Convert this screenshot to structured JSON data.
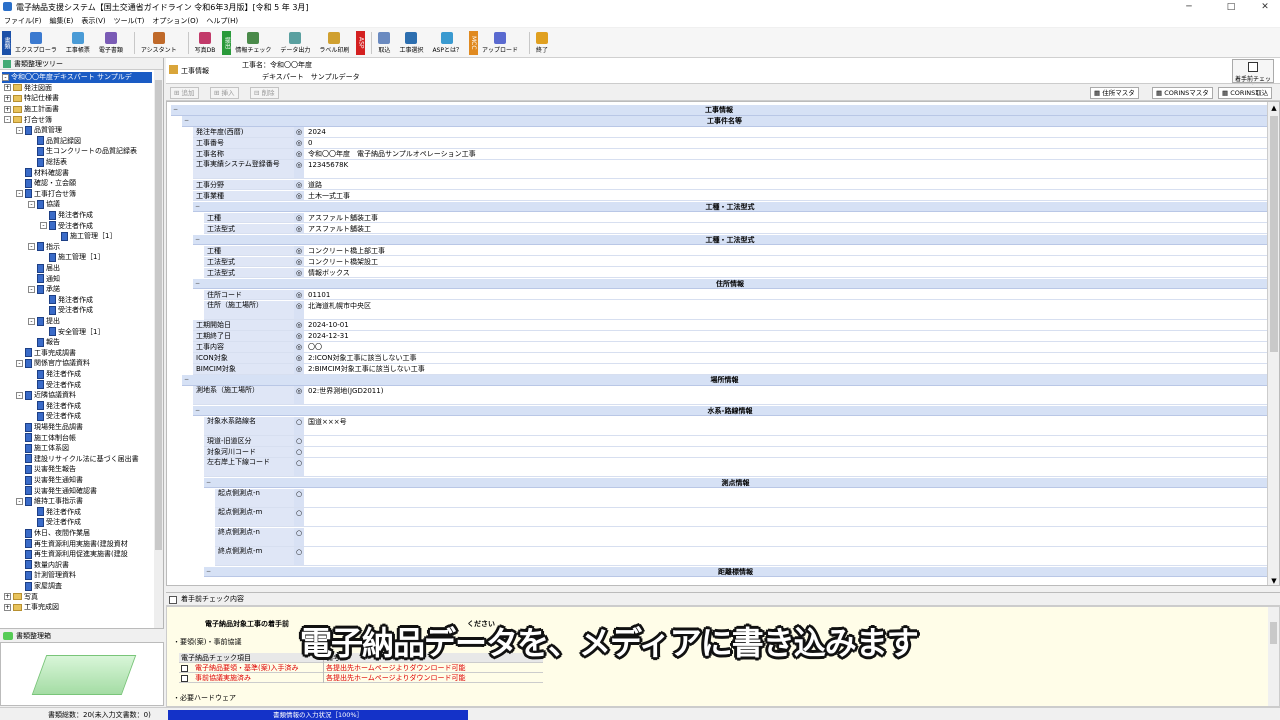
{
  "window": {
    "title": "電子納品支援システム【国土交通省ガイドライン 令和6年3月版】[令和 5 年 3月]"
  },
  "menu": [
    "ファイル(F)",
    "編集(E)",
    "表示(V)",
    "ツール(T)",
    "オプション(O)",
    "ヘルプ(H)"
  ],
  "toolbar": {
    "vtags": [
      "書類",
      "提出",
      "ASP",
      "MCC"
    ],
    "buttons": [
      "エクスプローラ",
      "工事帳票",
      "電子書類",
      "アシスタント",
      "写真DB",
      "情報チェック",
      "データ出力",
      "ラベル印刷",
      "取込",
      "工事選択",
      "ASPとは？",
      "アップロード",
      "終了"
    ]
  },
  "tree": {
    "header": "書類整理ツリー",
    "root": "令和〇〇年度デキスパート サンプルデ",
    "items": [
      {
        "label": "発注図面",
        "level": 0,
        "kind": "folder",
        "pm": "+"
      },
      {
        "label": "特記仕様書",
        "level": 0,
        "kind": "folder",
        "pm": "+"
      },
      {
        "label": "施工計画書",
        "level": 0,
        "kind": "folder",
        "pm": "+"
      },
      {
        "label": "打合せ簿",
        "level": 0,
        "kind": "folder",
        "pm": "-"
      },
      {
        "label": "品質管理",
        "level": 1,
        "kind": "doc",
        "pm": "-"
      },
      {
        "label": "品質記録図",
        "level": 2,
        "kind": "doc",
        "pm": ""
      },
      {
        "label": "生コンクリートの品質記録表",
        "level": 2,
        "kind": "doc",
        "pm": ""
      },
      {
        "label": "総括表",
        "level": 2,
        "kind": "doc",
        "pm": ""
      },
      {
        "label": "材料確認書",
        "level": 1,
        "kind": "doc",
        "pm": ""
      },
      {
        "label": "確認・立会願",
        "level": 1,
        "kind": "doc",
        "pm": ""
      },
      {
        "label": "工事打合せ簿",
        "level": 1,
        "kind": "doc",
        "pm": "-"
      },
      {
        "label": "協議",
        "level": 2,
        "kind": "doc",
        "pm": "-"
      },
      {
        "label": "発注者作成",
        "level": 3,
        "kind": "doc",
        "pm": ""
      },
      {
        "label": "受注者作成",
        "level": 3,
        "kind": "doc",
        "pm": "-"
      },
      {
        "label": "施工管理［1］",
        "level": 4,
        "kind": "doc",
        "pm": ""
      },
      {
        "label": "指示",
        "level": 2,
        "kind": "doc",
        "pm": "-"
      },
      {
        "label": "施工管理［1］",
        "level": 3,
        "kind": "doc",
        "pm": ""
      },
      {
        "label": "届出",
        "level": 2,
        "kind": "doc",
        "pm": ""
      },
      {
        "label": "通知",
        "level": 2,
        "kind": "doc",
        "pm": ""
      },
      {
        "label": "承諾",
        "level": 2,
        "kind": "doc",
        "pm": "-"
      },
      {
        "label": "発注者作成",
        "level": 3,
        "kind": "doc",
        "pm": ""
      },
      {
        "label": "受注者作成",
        "level": 3,
        "kind": "doc",
        "pm": ""
      },
      {
        "label": "提出",
        "level": 2,
        "kind": "doc",
        "pm": "-"
      },
      {
        "label": "安全管理［1］",
        "level": 3,
        "kind": "doc",
        "pm": ""
      },
      {
        "label": "報告",
        "level": 2,
        "kind": "doc",
        "pm": ""
      },
      {
        "label": "工事完成調書",
        "level": 1,
        "kind": "doc",
        "pm": ""
      },
      {
        "label": "関係官庁協議資料",
        "level": 1,
        "kind": "doc",
        "pm": "-"
      },
      {
        "label": "発注者作成",
        "level": 2,
        "kind": "doc",
        "pm": ""
      },
      {
        "label": "受注者作成",
        "level": 2,
        "kind": "doc",
        "pm": ""
      },
      {
        "label": "近隣協議資料",
        "level": 1,
        "kind": "doc",
        "pm": "-"
      },
      {
        "label": "発注者作成",
        "level": 2,
        "kind": "doc",
        "pm": ""
      },
      {
        "label": "受注者作成",
        "level": 2,
        "kind": "doc",
        "pm": ""
      },
      {
        "label": "現場発生品調書",
        "level": 1,
        "kind": "doc",
        "pm": ""
      },
      {
        "label": "施工体制台帳",
        "level": 1,
        "kind": "doc",
        "pm": ""
      },
      {
        "label": "施工体系図",
        "level": 1,
        "kind": "doc",
        "pm": ""
      },
      {
        "label": "建設リサイクル法に基づく届出書",
        "level": 1,
        "kind": "doc",
        "pm": ""
      },
      {
        "label": "災害発生報告",
        "level": 1,
        "kind": "doc",
        "pm": ""
      },
      {
        "label": "災害発生通知書",
        "level": 1,
        "kind": "doc",
        "pm": ""
      },
      {
        "label": "災害発生通知確認書",
        "level": 1,
        "kind": "doc",
        "pm": ""
      },
      {
        "label": "維持工事指示書",
        "level": 1,
        "kind": "doc",
        "pm": "-"
      },
      {
        "label": "発注者作成",
        "level": 2,
        "kind": "doc",
        "pm": ""
      },
      {
        "label": "受注者作成",
        "level": 2,
        "kind": "doc",
        "pm": ""
      },
      {
        "label": "休日、夜間作業届",
        "level": 1,
        "kind": "doc",
        "pm": ""
      },
      {
        "label": "再生資源利用実施書(建設資材",
        "level": 1,
        "kind": "doc",
        "pm": ""
      },
      {
        "label": "再生資源利用促進実施書(建設",
        "level": 1,
        "kind": "doc",
        "pm": ""
      },
      {
        "label": "数量内訳書",
        "level": 1,
        "kind": "doc",
        "pm": ""
      },
      {
        "label": "計測管理資料",
        "level": 1,
        "kind": "doc",
        "pm": ""
      },
      {
        "label": "家屋調査",
        "level": 1,
        "kind": "doc",
        "pm": ""
      },
      {
        "label": "写真",
        "level": 0,
        "kind": "folder",
        "pm": "+"
      },
      {
        "label": "工事完成図",
        "level": 0,
        "kind": "folder",
        "pm": "+"
      }
    ]
  },
  "bin": {
    "label": "書類整理箱"
  },
  "status": {
    "tree": "書類総数：20(未入力文書数：0)",
    "progress": "書類情報の入力状況［100%］"
  },
  "main": {
    "title": "工事情報",
    "name_label": "工事名：令和〇〇年度",
    "name_value": "デキスパート　サンプルデータ",
    "check_btn": "着手前チェック",
    "sub": {
      "add": "追加",
      "insert": "挿入",
      "delete": "削除",
      "addr": "住所マスタ",
      "corins_m": "CORINSマスタ",
      "corins_i": "CORINS取込"
    }
  },
  "form": {
    "rows": [
      {
        "t": "sec",
        "text": "工事情報",
        "d": 0
      },
      {
        "t": "sec",
        "text": "工事件名等",
        "d": 1
      },
      {
        "t": "f",
        "label": "発注年度(西暦)",
        "mark": "◎",
        "value": "2024",
        "d": 2
      },
      {
        "t": "f",
        "label": "工事番号",
        "mark": "◎",
        "value": "0",
        "d": 2
      },
      {
        "t": "f",
        "label": "工事名称",
        "mark": "◎",
        "value": "令和〇〇年度　電子納品サンプルオペレーション工事",
        "d": 2
      },
      {
        "t": "f2",
        "label": "工事実績システム登録番号",
        "mark": "◎",
        "value": "12345678K",
        "d": 2
      },
      {
        "t": "f",
        "label": "工事分野",
        "mark": "◎",
        "value": "道路",
        "d": 2
      },
      {
        "t": "f",
        "label": "工事業種",
        "mark": "◎",
        "value": "土木一式工事",
        "d": 2
      },
      {
        "t": "sec",
        "text": "工種・工法型式",
        "d": 2
      },
      {
        "t": "f",
        "label": "工種",
        "mark": "◎",
        "value": "アスファルト舗装工事",
        "d": 3
      },
      {
        "t": "f",
        "label": "工法型式",
        "mark": "◎",
        "value": "アスファルト舗装工",
        "d": 3
      },
      {
        "t": "sec",
        "text": "工種・工法型式",
        "d": 2
      },
      {
        "t": "f",
        "label": "工種",
        "mark": "◎",
        "value": "コンクリート橋上部工事",
        "d": 3
      },
      {
        "t": "f",
        "label": "工法型式",
        "mark": "◎",
        "value": "コンクリート橋架設工",
        "d": 3
      },
      {
        "t": "f",
        "label": "工法型式",
        "mark": "◎",
        "value": "情報ボックス",
        "d": 3
      },
      {
        "t": "sec",
        "text": "住所情報",
        "d": 2
      },
      {
        "t": "f",
        "label": "住所コード",
        "mark": "◎",
        "value": "01101",
        "d": 3
      },
      {
        "t": "f2",
        "label": "住所（施工場所）",
        "mark": "◎",
        "value": "北海道札幌市中央区",
        "d": 3
      },
      {
        "t": "f",
        "label": "工期開始日",
        "mark": "◎",
        "value": "2024-10-01",
        "d": 2
      },
      {
        "t": "f",
        "label": "工期終了日",
        "mark": "◎",
        "value": "2024-12-31",
        "d": 2
      },
      {
        "t": "f",
        "label": "工事内容",
        "mark": "◎",
        "value": "〇〇",
        "d": 2
      },
      {
        "t": "f",
        "label": "ICON対象",
        "mark": "◎",
        "value": "2:ICON対象工事に該当しない工事",
        "d": 2
      },
      {
        "t": "f",
        "label": "BIMCIM対象",
        "mark": "◎",
        "value": "2:BIMCIM対象工事に該当しない工事",
        "d": 2
      },
      {
        "t": "sec",
        "text": "場所情報",
        "d": 1
      },
      {
        "t": "f2",
        "label": "測地系（施工場所）",
        "mark": "◎",
        "value": "02:世界測地(JGD2011)",
        "d": 2
      },
      {
        "t": "sec",
        "text": "水系-路線情報",
        "d": 2
      },
      {
        "t": "f2",
        "label": "対象水系路線名",
        "mark": "○",
        "value": "国道×××号",
        "d": 3
      },
      {
        "t": "f",
        "label": "現道-旧道区分",
        "mark": "○",
        "value": "",
        "d": 3
      },
      {
        "t": "f",
        "label": "対象河川コード",
        "mark": "○",
        "value": "",
        "d": 3
      },
      {
        "t": "f2",
        "label": "左右岸上下線コード",
        "mark": "○",
        "value": "",
        "d": 3
      },
      {
        "t": "sec",
        "text": "測点情報",
        "d": 3
      },
      {
        "t": "f2",
        "label": "起点側測点-n",
        "mark": "○",
        "value": "",
        "d": 4
      },
      {
        "t": "f2",
        "label": "起点側測点-m",
        "mark": "○",
        "value": "",
        "d": 4
      },
      {
        "t": "f2",
        "label": "終点側測点-n",
        "mark": "○",
        "value": "",
        "d": 4
      },
      {
        "t": "f2",
        "label": "終点側測点-m",
        "mark": "○",
        "value": "",
        "d": 4
      },
      {
        "t": "sec",
        "text": "距離標情報",
        "d": 3
      }
    ]
  },
  "check": {
    "header": "着手前チェック内容",
    "intro": "電子納品対象工事の着手前",
    "intro_end": "ください",
    "sec1": "・要領(案)・事前協議",
    "col1": "電子納品チェック項目",
    "col2": "備考",
    "items": [
      {
        "item": "電子納品要領・基準(案)入手済み",
        "note": "各提出先ホームページよりダウンロード可能"
      },
      {
        "item": "事前協議実施済み",
        "note": "各提出先ホームページよりダウンロード可能"
      }
    ],
    "sec2": "・必要ハードウェア"
  },
  "caption": "電子納品データを、メディアに書き込みます",
  "colors": {
    "selection": "#1a5bc4",
    "section": "#d6e1f5",
    "progress": "#1432c8",
    "alert": "#dd0000"
  }
}
